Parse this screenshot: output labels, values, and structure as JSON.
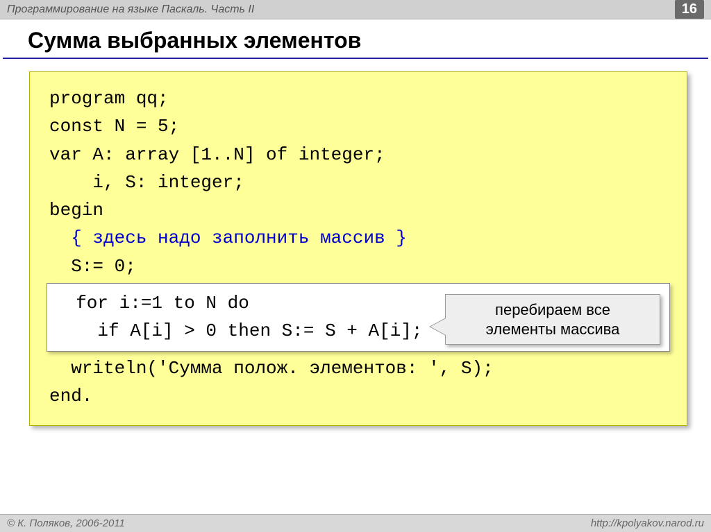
{
  "header": {
    "title": "Программирование на языке Паскаль. Часть II",
    "page": "16"
  },
  "title": "Сумма выбранных элементов",
  "code": {
    "l1": "program qq;",
    "l2": "const N = 5;",
    "l3": "var A: array [1..N] of integer;",
    "l4": "    i, S: integer;",
    "l5": "begin",
    "l6": "  { здесь надо заполнить массив }",
    "l7": "  S:= 0;",
    "l8": "  for i:=1 to N do",
    "l9": "    if A[i] > 0 then S:= S + A[i];",
    "l10": "  writeln('Сумма полож. элементов: ', S);",
    "l11": "end."
  },
  "callout": {
    "line1": "перебираем все",
    "line2": "элементы массива"
  },
  "footer": {
    "left": "© К. Поляков, 2006-2011",
    "right": "http://kpolyakov.narod.ru"
  }
}
